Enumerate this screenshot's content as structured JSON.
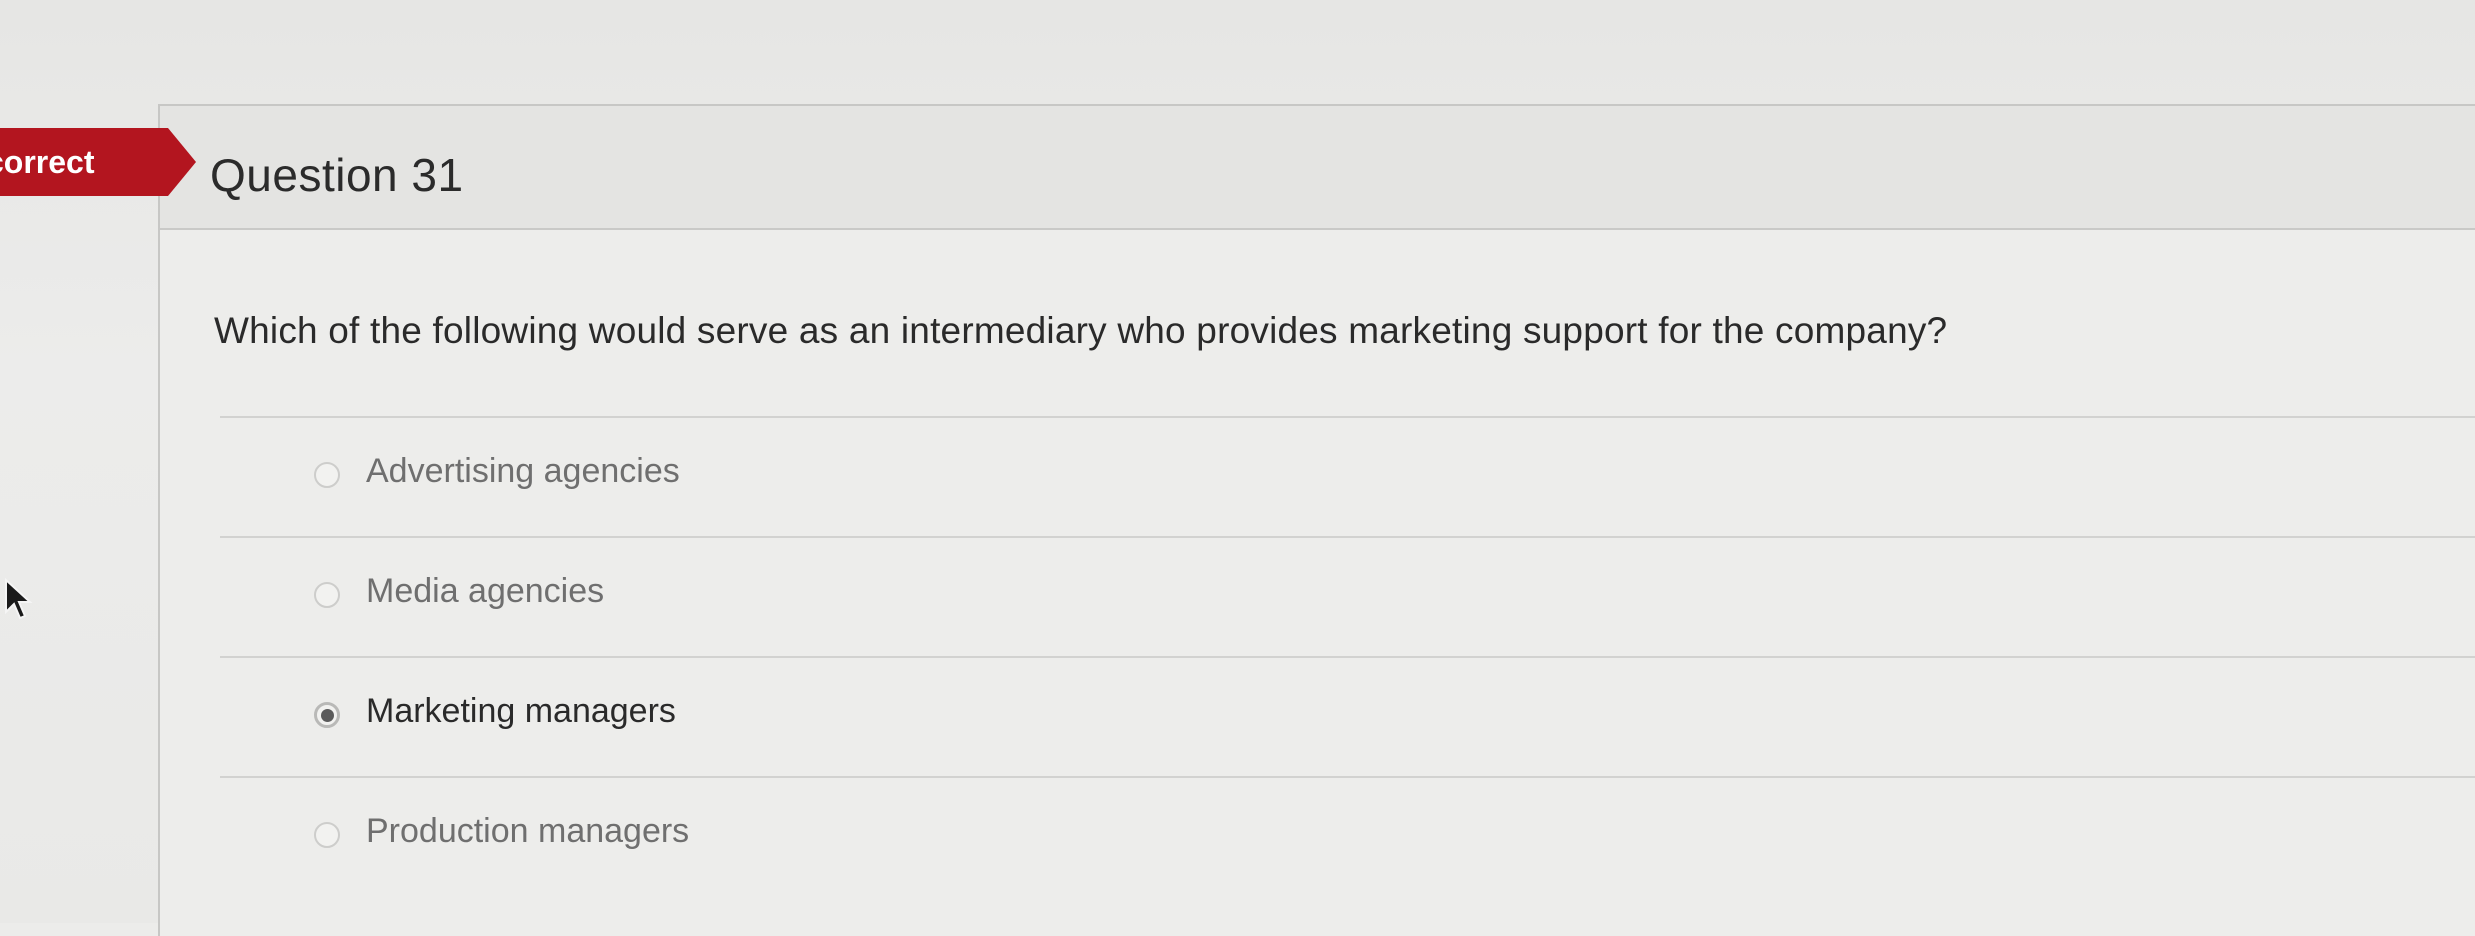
{
  "status": {
    "label": "correct",
    "color": "#b3151f"
  },
  "question": {
    "title": "Question 31",
    "text": "Which of the following would serve as an intermediary who provides marketing support for the company?"
  },
  "answers": [
    {
      "label": "Advertising agencies",
      "selected": false
    },
    {
      "label": "Media agencies",
      "selected": false
    },
    {
      "label": "Marketing managers",
      "selected": true
    },
    {
      "label": "Production managers",
      "selected": false
    }
  ]
}
